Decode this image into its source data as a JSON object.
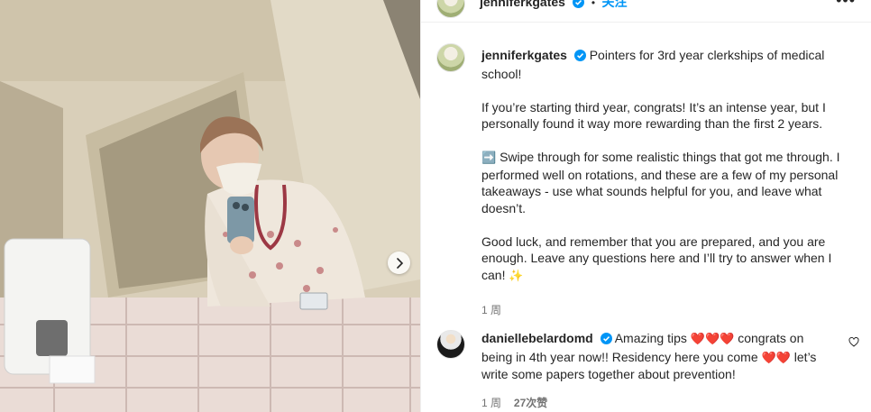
{
  "header": {
    "username": "jenniferkgates",
    "dot": "•",
    "follow_label": "关注",
    "more_label": "•••"
  },
  "post": {
    "username": "jenniferkgates",
    "title": "Pointers for 3rd year clerkships of medical school!",
    "paragraphs": [
      "If you’re starting third year, congrats! It’s an intense year, but I personally found it way more rewarding than the first 2 years.",
      "Swipe through for some realistic things that got me through. I performed well on rotations, and these are a few of my personal takeaways - use what sounds helpful for you, and leave what doesn’t.",
      "Good luck, and remember that you are prepared, and you are enough. Leave any questions here and I’ll try to answer when I can!"
    ],
    "arrow_emoji": "➡️",
    "sparkle_emoji": "✨",
    "time": "1 周"
  },
  "comment": {
    "username": "daniellebelardomd",
    "text_part1": "Amazing tips",
    "hearts1": "❤️❤️❤️",
    "text_part2": "congrats on being in 4th year now!! Residency here you come",
    "hearts2": "❤️❤️",
    "text_part3": "let’s write some papers together about prevention!",
    "time": "1 周",
    "likes": "27次赞"
  },
  "icons": {
    "verified": "verified-badge-icon",
    "heart": "heart-outline-icon",
    "next": "chevron-right-icon"
  },
  "colors": {
    "accent": "#0095f6",
    "text": "#262626",
    "muted": "#737373",
    "heart": "#ed4956"
  }
}
